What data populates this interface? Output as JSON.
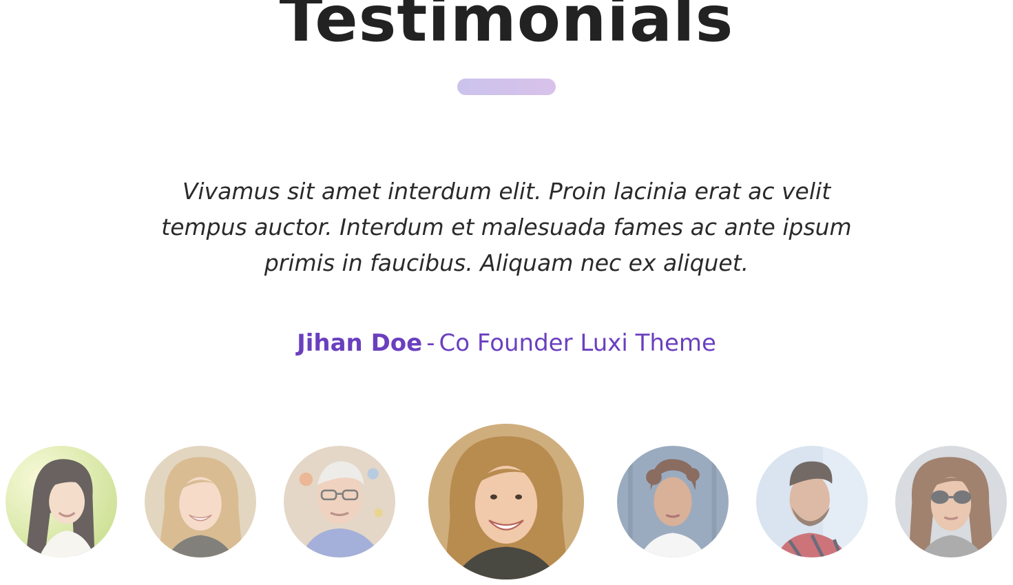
{
  "section": {
    "title": "Testimonials"
  },
  "testimonial": {
    "quote": "Vivamus sit amet interdum elit. Proin lacinia erat ac velit tempus auctor. Interdum et malesuada fames ac ante ipsum primis in faucibus. Aliquam nec ex aliquet.",
    "author_name": "Jihan Doe",
    "separator": "-",
    "author_role": "Co Founder Luxi Theme"
  },
  "colors": {
    "accent": "#6a3fbf",
    "divider_start": "#cbc3ec",
    "divider_end": "#d8c2ea",
    "title": "#222222",
    "quote": "#2a2a2a"
  },
  "avatars": [
    {
      "icon": "avatar-woman-dark-hair-icon",
      "active": false
    },
    {
      "icon": "avatar-woman-blonde-icon",
      "active": false
    },
    {
      "icon": "avatar-older-man-glasses-icon",
      "active": false
    },
    {
      "icon": "avatar-woman-blonde-icon",
      "active": true
    },
    {
      "icon": "avatar-woman-curly-hair-icon",
      "active": false
    },
    {
      "icon": "avatar-man-beard-icon",
      "active": false
    },
    {
      "icon": "avatar-woman-sunglasses-icon",
      "active": false
    }
  ]
}
